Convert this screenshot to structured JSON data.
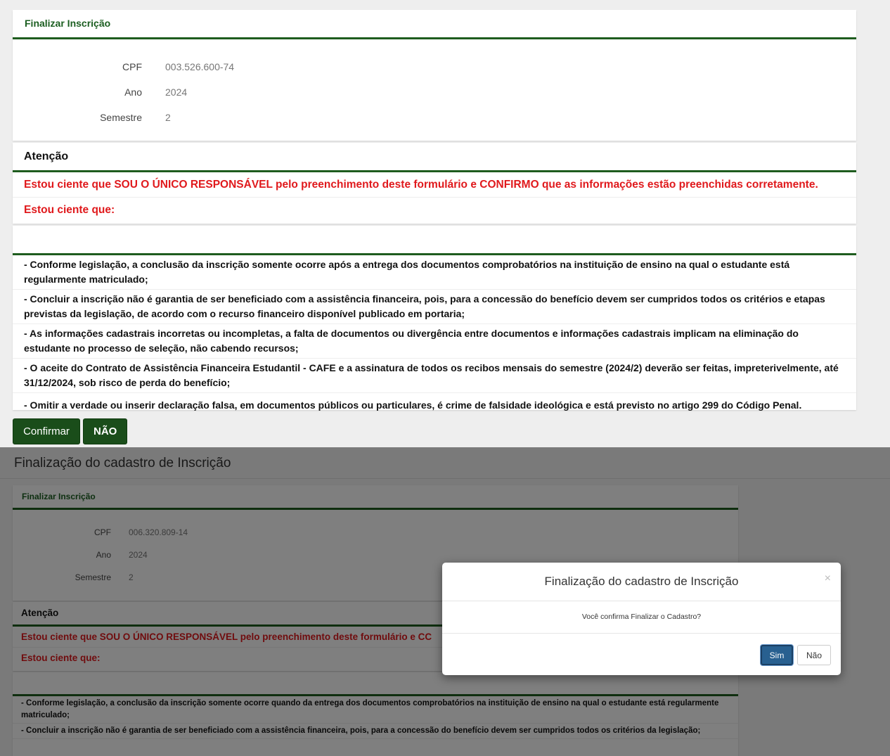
{
  "top": {
    "card_title": "Finalizar Inscrição",
    "fields": [
      {
        "label": "CPF",
        "value": "003.526.600-74"
      },
      {
        "label": "Ano",
        "value": "2024"
      },
      {
        "label": "Semestre",
        "value": "2"
      }
    ],
    "attention_title": "Atenção",
    "red_lines": [
      "Estou ciente que SOU O ÚNICO RESPONSÁVEL pelo preenchimento deste formulário e CONFIRMO que as informações estão preenchidas corretamente.",
      "Estou ciente que:"
    ],
    "items": [
      "- Conforme legislação, a conclusão da inscrição somente ocorre após a entrega dos documentos comprobatórios na instituição de ensino na qual o estudante está regularmente matriculado;",
      "- Concluir a inscrição não é garantia de ser beneficiado com a assistência financeira, pois, para a concessão do benefício devem ser cumpridos todos os critérios e etapas previstas da legislação, de acordo com o recurso financeiro disponível publicado em portaria;",
      "- As informações cadastrais incorretas ou incompletas, a falta de documentos ou divergência entre documentos e informações cadastrais implicam na eliminação do estudante no processo de seleção, não cabendo recursos;",
      "- O aceite do Contrato de Assistência Financeira Estudantil - CAFE e a assinatura de todos os recibos mensais do semestre (2024/2) deverão ser feitas, impreterivelmente, até 31/12/2024, sob risco de perda do benefício;",
      "- Omitir a verdade ou inserir declaração falsa, em documentos públicos ou particulares, é crime de falsidade ideológica e está previsto no artigo 299 do Código Penal."
    ],
    "confirm_label": "Confirmar",
    "no_label": "NÃO"
  },
  "bottom": {
    "page_title": "Finalização do cadastro de Inscrição",
    "card_title": "Finalizar Inscrição",
    "fields": [
      {
        "label": "CPF",
        "value": "006.320.809-14"
      },
      {
        "label": "Ano",
        "value": "2024"
      },
      {
        "label": "Semestre",
        "value": "2"
      }
    ],
    "attention_title": "Atenção",
    "red_lines": [
      "Estou ciente que SOU O ÚNICO RESPONSÁVEL pelo preenchimento deste formulário e CC",
      "Estou ciente que:"
    ],
    "items": [
      "- Conforme legislação, a conclusão da inscrição somente ocorre quando da entrega dos documentos comprobatórios na instituição de ensino na qual o estudante está regularmente matriculado;",
      "- Concluir a inscrição não é garantia de ser beneficiado com a assistência financeira, pois, para a concessão do benefício devem ser cumpridos todos os critérios da legislação;"
    ],
    "modal": {
      "title": "Finalização do cadastro de Inscrição",
      "close": "×",
      "message": "Você confirma Finalizar o Cadastro?",
      "yes_label": "Sim",
      "no_label": "Não"
    }
  }
}
